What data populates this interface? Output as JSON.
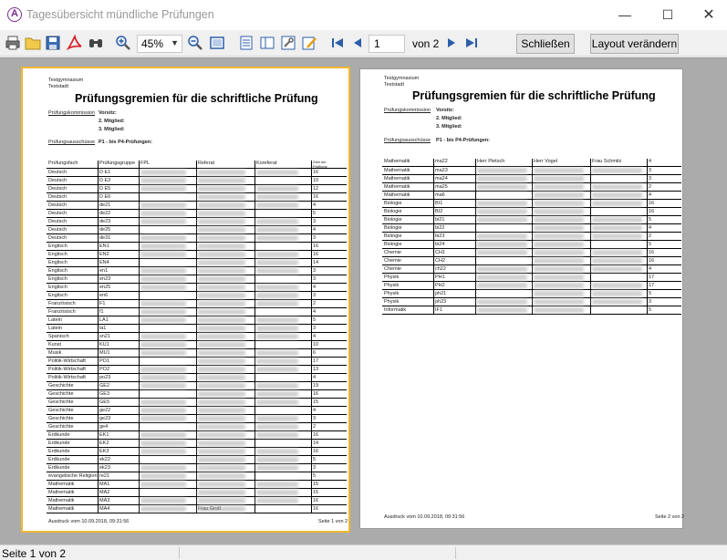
{
  "window": {
    "title": "Tagesübersicht mündliche Prüfungen"
  },
  "toolbar": {
    "zoom": "45%",
    "page_number": "1",
    "page_of": "von 2",
    "close_label": "Schließen",
    "layout_label": "Layout verändern"
  },
  "report": {
    "school": "Testgymnasium",
    "city": "Teststadt",
    "title": "Prüfungsgremien für die schriftliche Prüfung",
    "kommission_label": "Prüfungskommission",
    "vorsitz_label": "Vorsitz:",
    "mitglied2_label": "2. Mitglied:",
    "mitglied3_label": "3. Mitglied:",
    "ausschuesse_label": "Prüfungsausschüsse",
    "ausschuesse_value": "P1 - bis P4-Prüfungen:",
    "footer_print": "Ausdruck vom 10.09.2018, 09:31:56",
    "page1_footer": "Seite 1 von 2",
    "page2_footer": "Seite 2 von 2",
    "page1_columns": [
      "Prüfungsfach",
      "Prüfungsgruppe",
      "FPL",
      "Referat",
      "Koreferat",
      "Zahl der Prüflinge"
    ],
    "page2_columns": [
      "Mathematik",
      "ma22",
      "Herr Pietsch",
      "Herr Vogel",
      "Frau Schmitz",
      "4"
    ],
    "page1_rows": [
      [
        "Deutsch",
        "D E1",
        "16"
      ],
      [
        "Deutsch",
        "D E3",
        "10"
      ],
      [
        "Deutsch",
        "D E5",
        "12"
      ],
      [
        "Deutsch",
        "D E6",
        "16"
      ],
      [
        "Deutsch",
        "de21",
        "4"
      ],
      [
        "Deutsch",
        "de22",
        "5"
      ],
      [
        "Deutsch",
        "de23",
        "3"
      ],
      [
        "Deutsch",
        "de25",
        "4"
      ],
      [
        "Deutsch",
        "de31",
        "3"
      ],
      [
        "Englisch",
        "EN1",
        "16"
      ],
      [
        "Englisch",
        "EN2",
        "16"
      ],
      [
        "Englisch",
        "EN4",
        "14"
      ],
      [
        "Englisch",
        "en1",
        "3"
      ],
      [
        "Englisch",
        "en23",
        "3"
      ],
      [
        "Englisch",
        "en25",
        "4"
      ],
      [
        "Englisch",
        "en6",
        "3"
      ],
      [
        "Französisch",
        "F1",
        "2"
      ],
      [
        "Französisch",
        "f1",
        "4"
      ],
      [
        "Latein",
        "LA1",
        "5"
      ],
      [
        "Latein",
        "la1",
        "3"
      ],
      [
        "Spanisch",
        "sn21",
        "4"
      ],
      [
        "Kunst",
        "KU1",
        "10"
      ],
      [
        "Musik",
        "MU1",
        "6"
      ],
      [
        "Politik-Wirtschaft",
        "PO1",
        "17"
      ],
      [
        "Politik-Wirtschaft",
        "PO2",
        "13"
      ],
      [
        "Politik-Wirtschaft",
        "po23",
        "4"
      ],
      [
        "Geschichte",
        "GE2",
        "19"
      ],
      [
        "Geschichte",
        "GE3",
        "16"
      ],
      [
        "Geschichte",
        "GE5",
        "15"
      ],
      [
        "Geschichte",
        "ge22",
        "4"
      ],
      [
        "Geschichte",
        "ge23",
        "3"
      ],
      [
        "Geschichte",
        "ge4",
        "2"
      ],
      [
        "Erdkunde",
        "EK1",
        "16"
      ],
      [
        "Erdkunde",
        "EK2",
        "14"
      ],
      [
        "Erdkunde",
        "EK3",
        "16"
      ],
      [
        "Erdkunde",
        "ek22",
        "5"
      ],
      [
        "Erdkunde",
        "ek23",
        "3"
      ],
      [
        "evangelische Religion",
        "re21",
        "5"
      ],
      [
        "Mathematik",
        "MA1",
        "15"
      ],
      [
        "Mathematik",
        "MA2",
        "15"
      ],
      [
        "Mathematik",
        "MA3",
        "16"
      ],
      [
        "Mathematik",
        "MA4",
        "16"
      ]
    ],
    "page1_last_row_note": "Frau Groß",
    "page2_rows": [
      [
        "Mathematik",
        "ma23",
        "3"
      ],
      [
        "Mathematik",
        "ma24",
        "3"
      ],
      [
        "Mathematik",
        "ma25",
        "2"
      ],
      [
        "Mathematik",
        "ma6",
        "4"
      ],
      [
        "Biologie",
        "BI1",
        "16"
      ],
      [
        "Biologie",
        "BI2",
        "16"
      ],
      [
        "Biologie",
        "bi21",
        "5"
      ],
      [
        "Biologie",
        "bi22",
        "4"
      ],
      [
        "Biologie",
        "bi23",
        "2"
      ],
      [
        "Biologie",
        "bi24",
        "5"
      ],
      [
        "Chemie",
        "CH1",
        "16"
      ],
      [
        "Chemie",
        "CH2",
        "16"
      ],
      [
        "Chemie",
        "ch22",
        "4"
      ],
      [
        "Physik",
        "PH1",
        "17"
      ],
      [
        "Physik",
        "PH2",
        "17"
      ],
      [
        "Physik",
        "ph21",
        "5"
      ],
      [
        "Physik",
        "ph23",
        "3"
      ],
      [
        "Informatik",
        "IF1",
        "5"
      ]
    ]
  },
  "status": {
    "text": "Seite 1 von 2"
  }
}
